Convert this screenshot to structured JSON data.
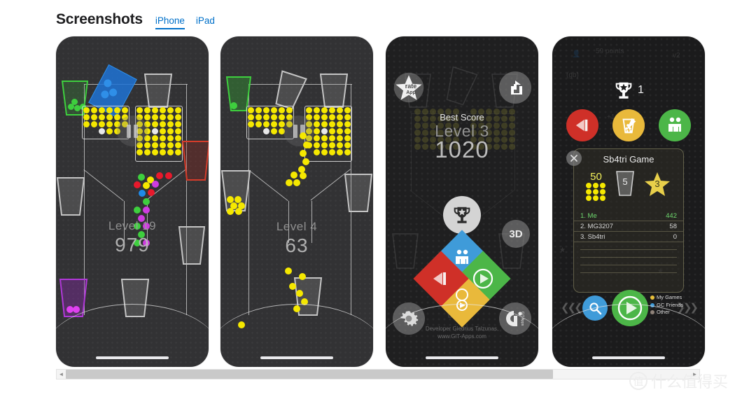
{
  "header": {
    "title": "Screenshots",
    "tabs": [
      {
        "label": "iPhone",
        "active": true
      },
      {
        "label": "iPad",
        "active": false
      }
    ]
  },
  "screenshots": [
    {
      "id": "gameplay-level-19",
      "level_label": "Level 19",
      "score": "979",
      "pause_icon": "pause-icon",
      "cups": [
        {
          "name": "green-cup",
          "color": "#3ecf3e",
          "balls": 4,
          "ball_color": "#3ecf3e"
        },
        {
          "name": "grey-cup-top",
          "color": "#b9b9b9",
          "balls": 0
        },
        {
          "name": "red-cup",
          "color": "#d63c2a",
          "balls": 0
        },
        {
          "name": "grey-cup-left",
          "color": "#b9b9b9",
          "balls": 0
        },
        {
          "name": "purple-cup",
          "color": "#b038d8",
          "balls": 2,
          "ball_color": "#e040f0"
        },
        {
          "name": "grey-cup-center",
          "color": "#b9b9b9",
          "balls": 0
        },
        {
          "name": "grey-cup-mid",
          "color": "#b9b9b9",
          "balls": 0
        }
      ],
      "blocks": [
        {
          "name": "blue-paddle",
          "color": "#1f73d6"
        }
      ],
      "ball_colors": [
        "#3ecf3e",
        "#f5e800",
        "#e8192c",
        "#cf3ce0",
        "#1f8ae8",
        "#e8192c"
      ]
    },
    {
      "id": "gameplay-level-4",
      "level_label": "Level 4",
      "score": "63",
      "pause_icon": "pause-icon",
      "cups": [
        {
          "name": "green-cup",
          "color": "#3ecf3e",
          "balls": 1,
          "ball_color": "#3ecf3e"
        },
        {
          "name": "grey-cup-top-right",
          "color": "#b9b9b9",
          "balls": 0
        },
        {
          "name": "grey-cup-tilted",
          "color": "#b9b9b9",
          "balls": 0
        },
        {
          "name": "grey-cup-right",
          "color": "#b9b9b9",
          "balls": 0
        },
        {
          "name": "grey-cup-bottom-left",
          "color": "#b9b9b9",
          "balls": 9,
          "ball_color": "#f5e800"
        },
        {
          "name": "grey-cup-bottom",
          "color": "#b9b9b9",
          "balls": 0
        }
      ]
    },
    {
      "id": "main-menu",
      "best_score_label": "Best Score",
      "best_level": "Level 3",
      "best_value": "1020",
      "rate_button": {
        "line1": "rate",
        "line2": "App",
        "icon": "star-icon"
      },
      "share_button": {
        "icon": "share-icon"
      },
      "trophy_button": {
        "icon": "trophy-icon"
      },
      "mode_3d_button": {
        "label": "3D"
      },
      "settings_button": {
        "icon": "gear-icon"
      },
      "info_button": {
        "icon": "git-apps-logo-icon",
        "label": "GiT Apps"
      },
      "diamond_buttons": [
        {
          "name": "multiplayer",
          "icon": "two-people-icon",
          "color": "#3f9bd9"
        },
        {
          "name": "play",
          "icon": "play-circle-icon",
          "color": "#4cb648"
        },
        {
          "name": "replay",
          "icon": "replay-circle-icon",
          "color": "#e9b93b"
        },
        {
          "name": "back",
          "icon": "back-arrow-icon",
          "color": "#cf3028"
        }
      ],
      "developer_line1": "Developer Giedrius Talzunas,",
      "developer_line2": "www.GiT-Apps.com"
    },
    {
      "id": "leaderboard",
      "trophy_count": "1",
      "round_buttons": [
        {
          "name": "back-button",
          "icon": "back-arrow-icon",
          "color": "#cf3028"
        },
        {
          "name": "edit-score-button",
          "icon": "cup-pencil-icon",
          "color": "#e9b93b"
        },
        {
          "name": "friends-button",
          "icon": "people-icon",
          "color": "#4cb648"
        }
      ],
      "panel": {
        "title": "Sb4tri Game",
        "close_icon": "close-icon",
        "stats": [
          {
            "name": "balls-stat",
            "value": "50",
            "icon": "ball-grid-icon"
          },
          {
            "name": "cup-stat",
            "value": "5",
            "icon": "cup-icon"
          },
          {
            "name": "star-stat",
            "value": "3",
            "icon": "star-icon"
          }
        ],
        "rows": [
          {
            "rank": "1. Me",
            "score": "442",
            "highlight": true
          },
          {
            "rank": "2. MG3207",
            "score": "58",
            "highlight": false
          },
          {
            "rank": "3. Sb4tri",
            "score": "0",
            "highlight": false
          }
        ]
      },
      "search_button": {
        "icon": "search-icon",
        "color": "#3f9bd9"
      },
      "play_button": {
        "icon": "play-icon",
        "color": "#4cb648"
      },
      "legend": [
        {
          "label": "My Games",
          "color": "#e8c03a"
        },
        {
          "label": "GC Friends",
          "color": "#3f9bd9"
        },
        {
          "label": "Other",
          "color": "#8e8279"
        }
      ],
      "nav_left": "❮❮❮",
      "nav_right": "❯❯❯"
    }
  ],
  "scrollbar": {
    "left_arrow": "◄",
    "right_arrow": "►"
  },
  "watermark": {
    "mark": "值",
    "text": "什么值得买"
  }
}
